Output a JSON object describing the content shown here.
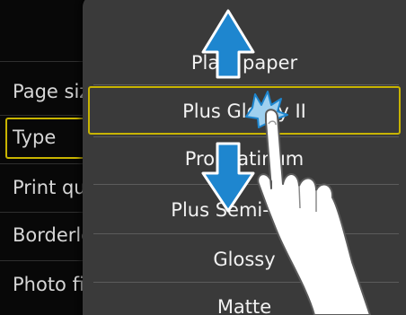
{
  "left_menu": {
    "items": [
      {
        "label": "Page size"
      },
      {
        "label": "Type"
      },
      {
        "label": "Print quality"
      },
      {
        "label": "Borderless"
      },
      {
        "label": "Photo fix"
      }
    ],
    "selected": "Type"
  },
  "media_list": {
    "items": [
      {
        "label": "Plain paper"
      },
      {
        "label": "Plus Glossy II"
      },
      {
        "label": "Pro Platinum"
      },
      {
        "label": "Plus Semi-gloss"
      },
      {
        "label": "Glossy"
      },
      {
        "label": "Matte"
      }
    ],
    "selected": "Plus Glossy II"
  },
  "colors": {
    "accent_selection": "#c8b400",
    "arrow": "#1e86cf",
    "screen_bg": "#080808",
    "panel_bg": "#3a3a3a"
  },
  "icons": [
    "up-arrow-icon",
    "down-arrow-icon",
    "hand-pointer-icon",
    "tap-sparkle-icon"
  ]
}
